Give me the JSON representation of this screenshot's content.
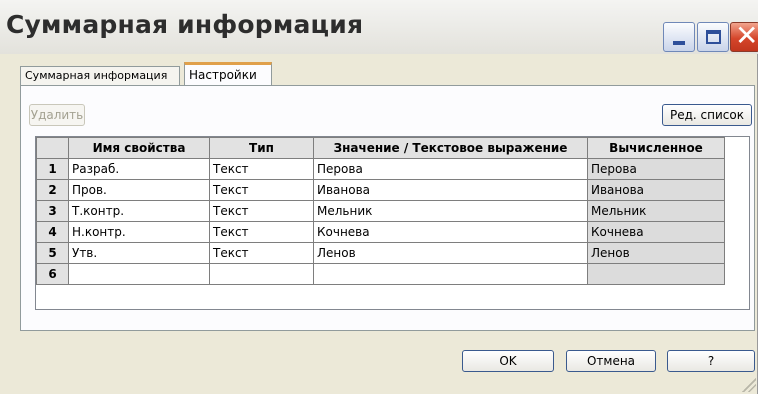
{
  "window": {
    "title": "Суммарная информация",
    "buttons": {
      "minimize": "minimize-icon",
      "maximize": "maximize-icon",
      "close": "close-icon"
    }
  },
  "tabs": [
    {
      "label": "Суммарная информация",
      "active": false
    },
    {
      "label": "Настройки",
      "active": true
    }
  ],
  "toolbar": {
    "delete_label": "Удалить",
    "edit_list_label": "Ред. список"
  },
  "table": {
    "columns": [
      "Имя свойства",
      "Тип",
      "Значение / Текстовое выражение",
      "Вычисленное"
    ],
    "rows": [
      {
        "num": "1",
        "name": "Разраб.",
        "type": "Текст",
        "value": "Перова",
        "computed": "Перова"
      },
      {
        "num": "2",
        "name": "Пров.",
        "type": "Текст",
        "value": "Иванова",
        "computed": "Иванова"
      },
      {
        "num": "3",
        "name": "Т.контр.",
        "type": "Текст",
        "value": "Мельник",
        "computed": "Мельник"
      },
      {
        "num": "4",
        "name": "Н.контр.",
        "type": "Текст",
        "value": "Кочнева",
        "computed": "Кочнева"
      },
      {
        "num": "5",
        "name": "Утв.",
        "type": "Текст",
        "value": "Ленов",
        "computed": "Ленов"
      },
      {
        "num": "6",
        "name": "",
        "type": "",
        "value": "",
        "computed": ""
      }
    ]
  },
  "footer": {
    "ok_label": "OK",
    "cancel_label": "Отмена",
    "help_label": "?"
  },
  "colors": {
    "window_bg": "#ece9d8",
    "tab_accent": "#e0a04a",
    "close_red": "#d5462b",
    "header_gray": "#e2e2e2"
  }
}
